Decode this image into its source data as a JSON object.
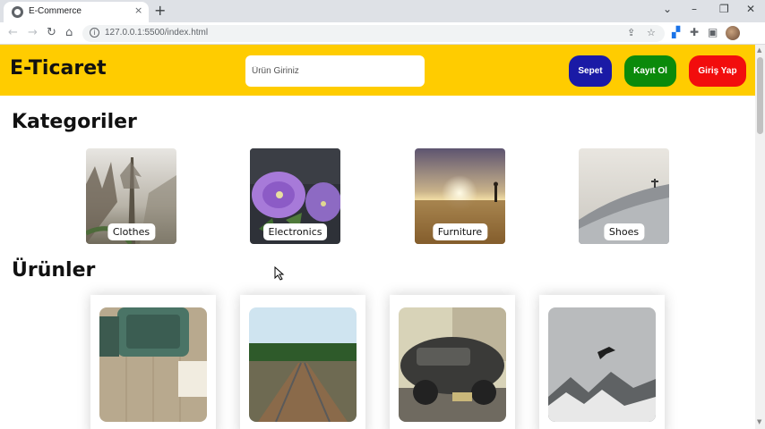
{
  "browser": {
    "tab_title": "E-Commerce",
    "tab_close": "×",
    "new_tab": "+",
    "url": "127.0.0.1:5500/index.html",
    "window_controls": {
      "dropdown": "⌄",
      "minimize": "–",
      "restore": "❐",
      "close": "✕"
    },
    "nav": {
      "back": "←",
      "forward": "→",
      "reload": "↻",
      "home": "⌂"
    }
  },
  "header": {
    "logo": "E-Ticaret",
    "search_placeholder": "Ürün Giriniz",
    "buttons": {
      "cart": "Sepet",
      "register": "Kayıt Ol",
      "login": "Giriş Yap"
    },
    "colors": {
      "header_bg": "#ffcc00",
      "cart": "#1a1aa6",
      "register": "#0b8a0b",
      "login": "#f20d0d"
    }
  },
  "categories": {
    "title": "Kategoriler",
    "items": [
      {
        "label": "Clothes"
      },
      {
        "label": "Electronics"
      },
      {
        "label": "Furniture"
      },
      {
        "label": "Shoes"
      }
    ]
  },
  "products": {
    "title": "Ürünler"
  }
}
